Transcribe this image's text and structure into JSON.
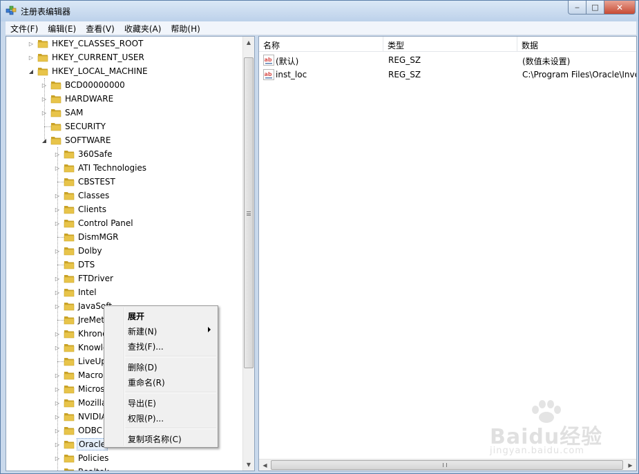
{
  "window": {
    "title": "注册表编辑器",
    "controls": {
      "minimize": "‒",
      "maximize": "□",
      "close": "✕"
    }
  },
  "menubar": {
    "items": [
      {
        "label": "文件(F)"
      },
      {
        "label": "编辑(E)"
      },
      {
        "label": "查看(V)"
      },
      {
        "label": "收藏夹(A)"
      },
      {
        "label": "帮助(H)"
      }
    ]
  },
  "tree": {
    "items": [
      {
        "label": "HKEY_CLASSES_ROOT",
        "level": 0,
        "expander": "collapsed"
      },
      {
        "label": "HKEY_CURRENT_USER",
        "level": 0,
        "expander": "collapsed"
      },
      {
        "label": "HKEY_LOCAL_MACHINE",
        "level": 0,
        "expander": "expanded"
      },
      {
        "label": "BCD00000000",
        "level": 1,
        "expander": "collapsed"
      },
      {
        "label": "HARDWARE",
        "level": 1,
        "expander": "collapsed"
      },
      {
        "label": "SAM",
        "level": 1,
        "expander": "collapsed"
      },
      {
        "label": "SECURITY",
        "level": 1,
        "expander": "none"
      },
      {
        "label": "SOFTWARE",
        "level": 1,
        "expander": "expanded"
      },
      {
        "label": "360Safe",
        "level": 2,
        "expander": "collapsed"
      },
      {
        "label": "ATI Technologies",
        "level": 2,
        "expander": "collapsed"
      },
      {
        "label": "CBSTEST",
        "level": 2,
        "expander": "none"
      },
      {
        "label": "Classes",
        "level": 2,
        "expander": "collapsed"
      },
      {
        "label": "Clients",
        "level": 2,
        "expander": "collapsed"
      },
      {
        "label": "Control Panel",
        "level": 2,
        "expander": "collapsed"
      },
      {
        "label": "DismMGR",
        "level": 2,
        "expander": "none"
      },
      {
        "label": "Dolby",
        "level": 2,
        "expander": "collapsed"
      },
      {
        "label": "DTS",
        "level": 2,
        "expander": "none"
      },
      {
        "label": "FTDriver",
        "level": 2,
        "expander": "collapsed"
      },
      {
        "label": "Intel",
        "level": 2,
        "expander": "collapsed"
      },
      {
        "label": "JavaSoft",
        "level": 2,
        "expander": "collapsed"
      },
      {
        "label": "JreMetrics",
        "level": 2,
        "expander": "none"
      },
      {
        "label": "Khronos",
        "level": 2,
        "expander": "collapsed"
      },
      {
        "label": "KnowledgeFeeds",
        "level": 2,
        "expander": "collapsed"
      },
      {
        "label": "LiveUpdate",
        "level": 2,
        "expander": "none"
      },
      {
        "label": "Macromedia",
        "level": 2,
        "expander": "collapsed"
      },
      {
        "label": "Microsoft",
        "level": 2,
        "expander": "collapsed"
      },
      {
        "label": "Mozilla",
        "level": 2,
        "expander": "collapsed"
      },
      {
        "label": "NVIDIA",
        "level": 2,
        "expander": "collapsed"
      },
      {
        "label": "ODBC",
        "level": 2,
        "expander": "collapsed"
      },
      {
        "label": "Oracle",
        "level": 2,
        "expander": "collapsed",
        "selected": true
      },
      {
        "label": "Policies",
        "level": 2,
        "expander": "collapsed"
      },
      {
        "label": "Realtek",
        "level": 2,
        "expander": "collapsed"
      }
    ]
  },
  "list": {
    "columns": [
      {
        "label": "名称"
      },
      {
        "label": "类型"
      },
      {
        "label": "数据"
      }
    ],
    "rows": [
      {
        "name": "(默认)",
        "type": "REG_SZ",
        "data": "(数值未设置)"
      },
      {
        "name": "inst_loc",
        "type": "REG_SZ",
        "data": "C:\\Program Files\\Oracle\\Inventory"
      }
    ]
  },
  "context_menu": {
    "items": [
      {
        "label": "展开",
        "bold": true
      },
      {
        "label": "新建(N)",
        "submenu": true
      },
      {
        "label": "查找(F)..."
      },
      {
        "separator": true
      },
      {
        "label": "删除(D)"
      },
      {
        "label": "重命名(R)"
      },
      {
        "separator": true
      },
      {
        "label": "导出(E)"
      },
      {
        "label": "权限(P)..."
      },
      {
        "separator": true
      },
      {
        "label": "复制项名称(C)"
      }
    ]
  },
  "watermark": {
    "brand": "Baidu经验",
    "sub": "jingyan.baidu.com"
  },
  "colors": {
    "folder": "#e8c44a",
    "folder_dark": "#c9a227",
    "selection": "#e6f0fb",
    "ab_icon": "#d9534f"
  }
}
